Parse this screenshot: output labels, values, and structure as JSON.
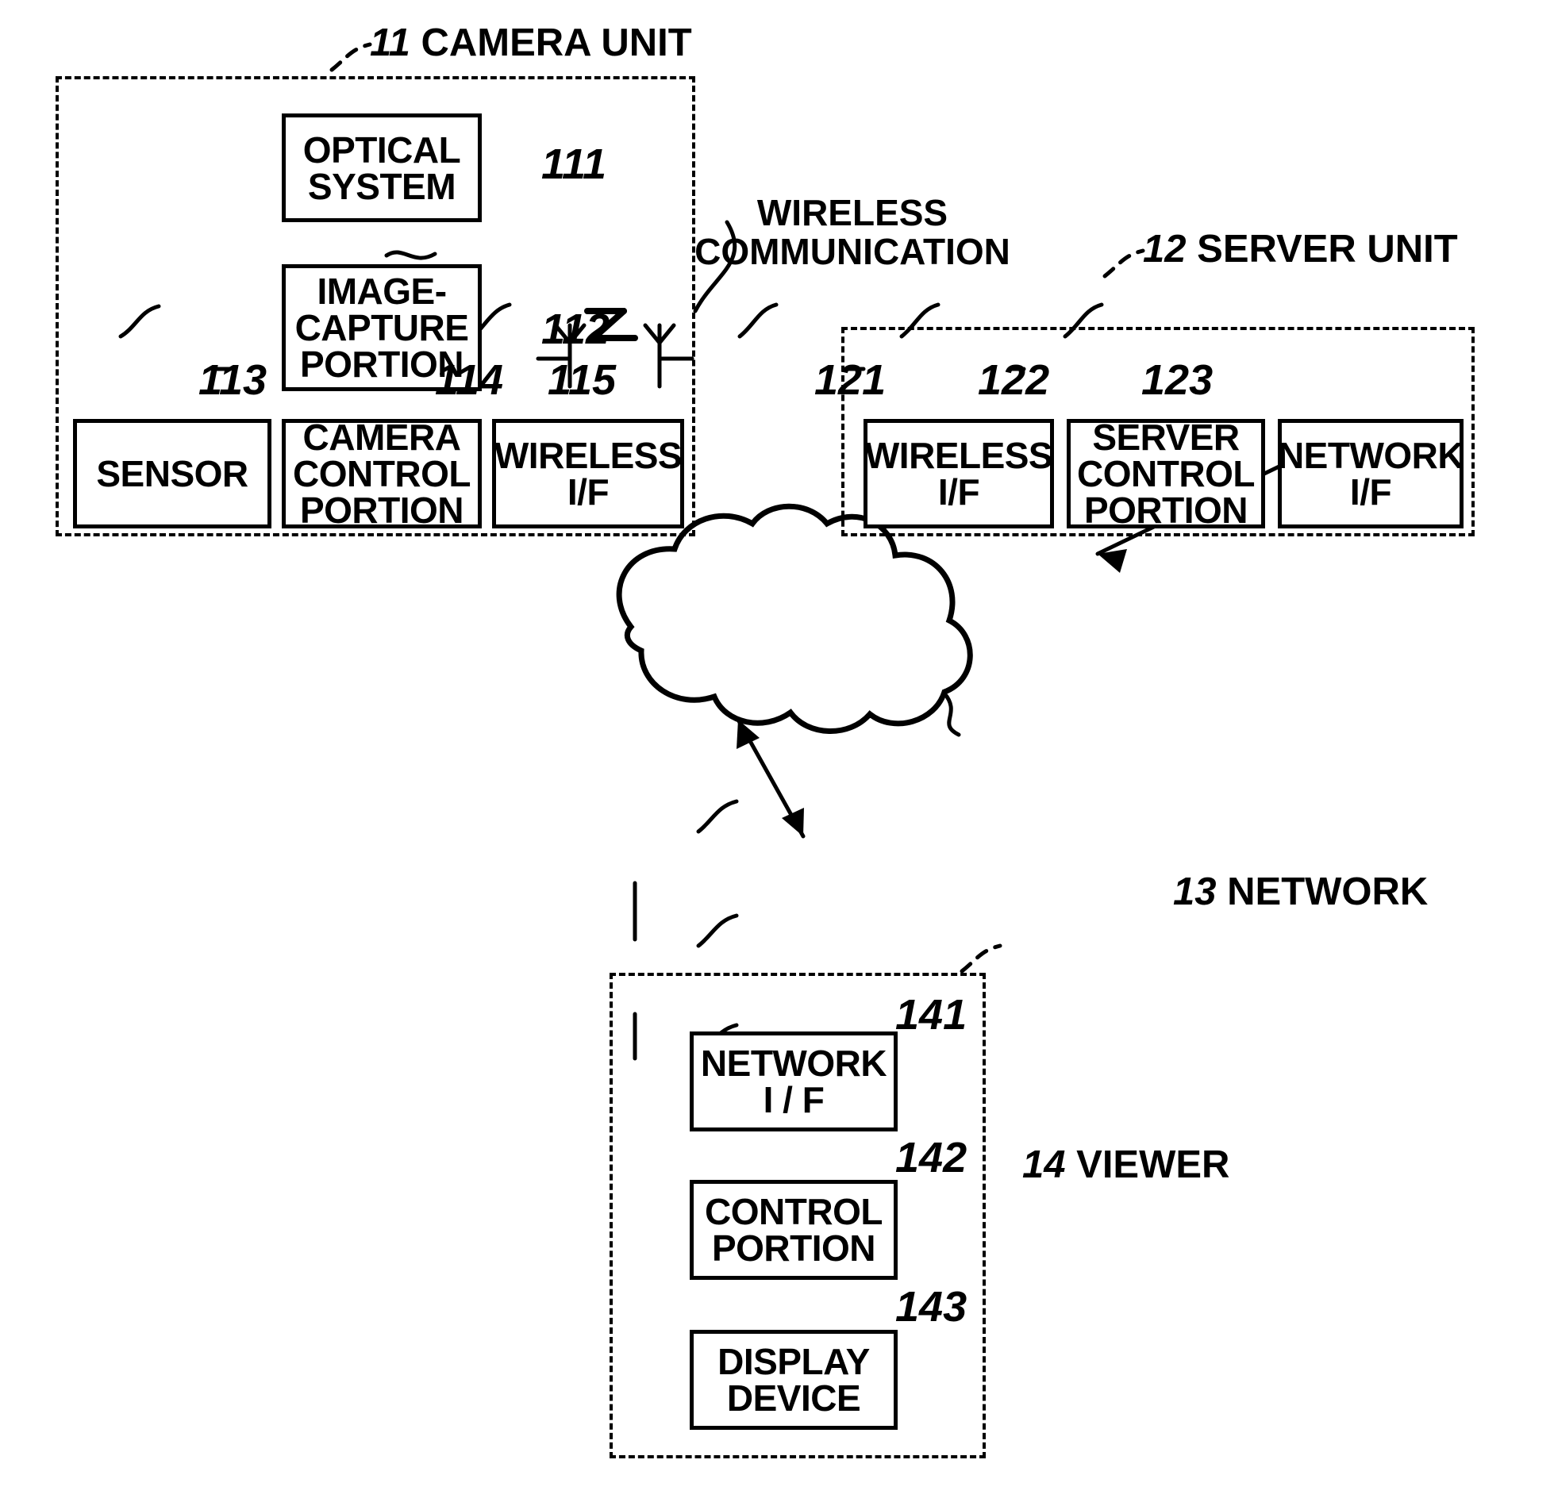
{
  "figure": {
    "kind": "patent-block-diagram",
    "background": "#ffffff",
    "ink": "#000000"
  },
  "units": [
    {
      "id": "11",
      "label": "CAMERA UNIT"
    },
    {
      "id": "12",
      "label": "SERVER UNIT"
    },
    {
      "id": "14",
      "label": "VIEWER"
    }
  ],
  "camera_unit": {
    "ref": "11",
    "name": "CAMERA UNIT",
    "blocks": [
      {
        "ref": "111",
        "label": "OPTICAL\nSYSTEM"
      },
      {
        "ref": "112",
        "label": "IMAGE-\nCAPTURE\nPORTION"
      },
      {
        "ref": "113",
        "label": "SENSOR"
      },
      {
        "ref": "114",
        "label": "CAMERA\nCONTROL\nPORTION"
      },
      {
        "ref": "115",
        "label": "WIRELESS\nI/F"
      }
    ]
  },
  "server_unit": {
    "ref": "12",
    "name": "SERVER UNIT",
    "blocks": [
      {
        "ref": "121",
        "label": "WIRELESS\nI/F"
      },
      {
        "ref": "122",
        "label": "SERVER\nCONTROL\nPORTION"
      },
      {
        "ref": "123",
        "label": "NETWORK\nI/F"
      }
    ]
  },
  "network": {
    "ref": "13",
    "name": "NETWORK"
  },
  "viewer": {
    "ref": "14",
    "name": "VIEWER",
    "blocks": [
      {
        "ref": "141",
        "label": "NETWORK\nI / F"
      },
      {
        "ref": "142",
        "label": "CONTROL\nPORTION"
      },
      {
        "ref": "143",
        "label": "DISPLAY\nDEVICE"
      }
    ]
  },
  "wireless_link": {
    "caption": "WIRELESS\nCOMMUNICATION",
    "symbol": "antenna-zigzag-antenna"
  }
}
